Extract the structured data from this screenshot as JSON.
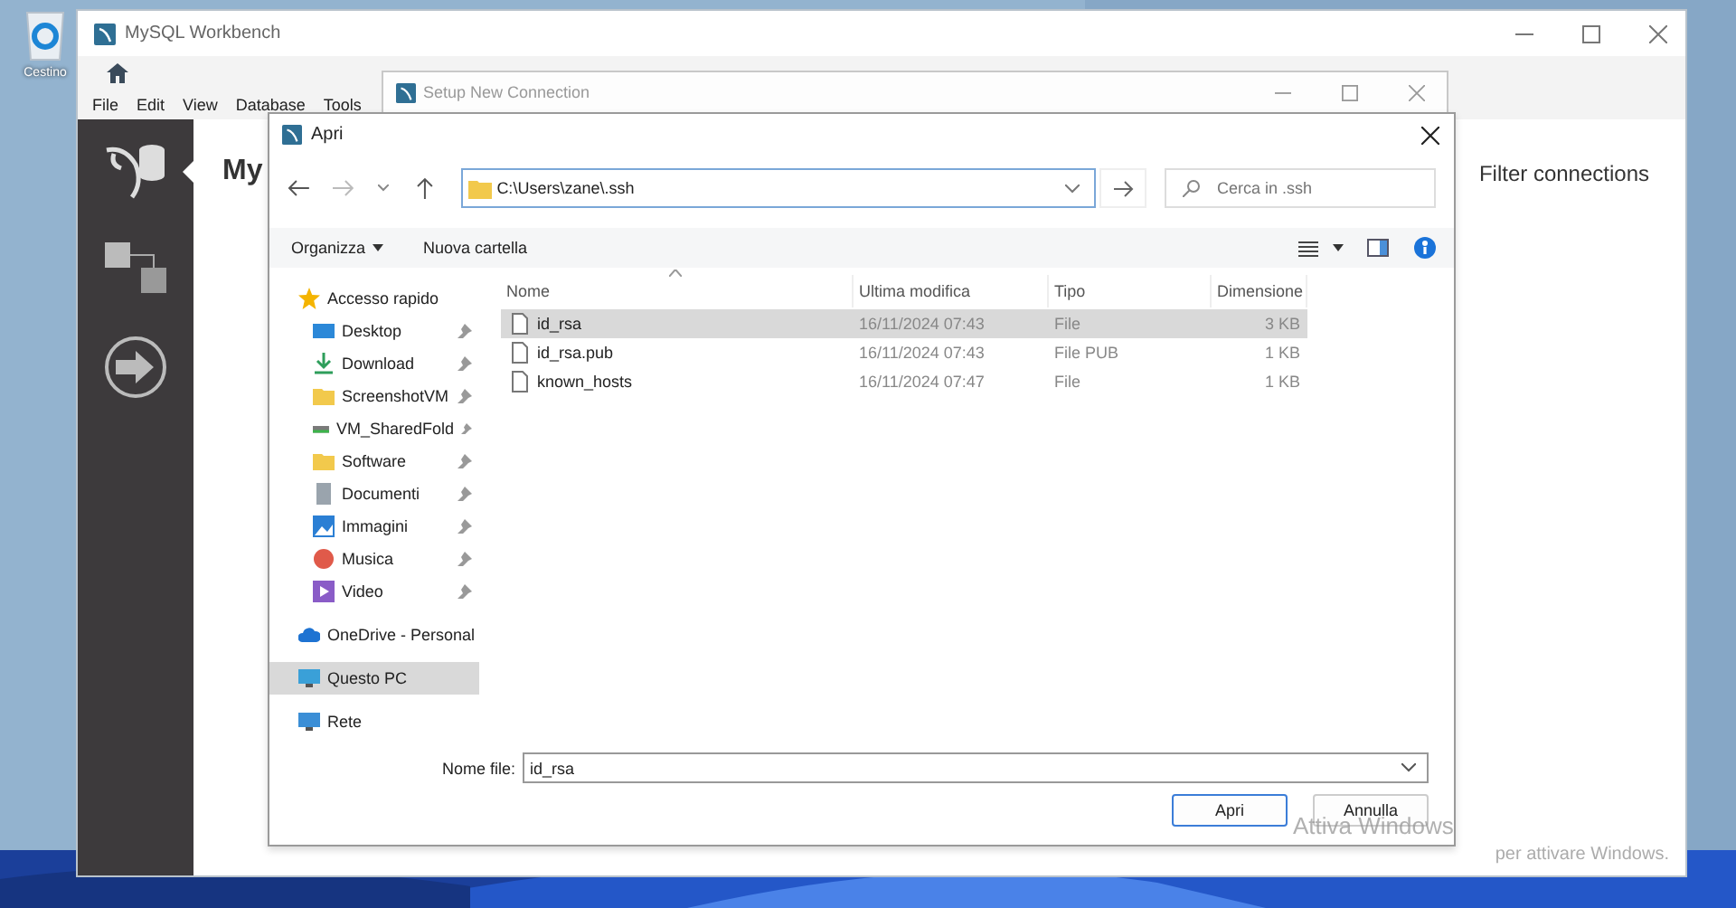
{
  "desktop": {
    "icons": [
      {
        "label": "Cestino"
      }
    ],
    "activation_notice": {
      "title": "Attiva Windows",
      "text": "per attivare Windows."
    }
  },
  "workbench": {
    "title": "MySQL Workbench",
    "menu": [
      "File",
      "Edit",
      "View",
      "Database",
      "Tools"
    ],
    "sidebar": [
      {
        "kind": "connections",
        "selected": true
      },
      {
        "kind": "models",
        "selected": false
      },
      {
        "kind": "migration",
        "selected": false
      }
    ],
    "heading": "My",
    "filter_label": "Filter connections"
  },
  "setup_dialog": {
    "title": "Setup New Connection"
  },
  "open_dialog": {
    "title": "Apri",
    "address": "C:\\Users\\zane\\.ssh",
    "search": {
      "placeholder": "Cerca in .ssh"
    },
    "toolbar": [
      {
        "label": "Organizza",
        "kind": "menu"
      },
      {
        "label": "Nuova cartella",
        "kind": "button"
      }
    ],
    "nav": [
      {
        "label": "Accesso rapido",
        "kind": "star",
        "selected": false,
        "children": [
          {
            "label": "Desktop",
            "kind": "desktop",
            "pinned": true,
            "selected": false
          },
          {
            "label": "Download",
            "kind": "download",
            "pinned": true,
            "selected": false
          },
          {
            "label": "ScreenshotVM",
            "kind": "folder",
            "pinned": true,
            "selected": false
          },
          {
            "label": "VM_SharedFold",
            "kind": "drive",
            "pinned": true,
            "selected": false
          },
          {
            "label": "Software",
            "kind": "folder",
            "pinned": true,
            "selected": false
          },
          {
            "label": "Documenti",
            "kind": "docs",
            "pinned": true,
            "selected": false
          },
          {
            "label": "Immagini",
            "kind": "pictures",
            "pinned": true,
            "selected": false
          },
          {
            "label": "Musica",
            "kind": "music",
            "pinned": true,
            "selected": false
          },
          {
            "label": "Video",
            "kind": "video",
            "pinned": true,
            "selected": false
          }
        ]
      },
      {
        "label": "OneDrive - Personal",
        "kind": "cloud",
        "selected": false
      },
      {
        "label": "Questo PC",
        "kind": "pc",
        "selected": true
      },
      {
        "label": "Rete",
        "kind": "network",
        "selected": false
      }
    ],
    "columns": [
      "Nome",
      "Ultima modifica",
      "Tipo",
      "Dimensione"
    ],
    "rows": [
      {
        "name": "id_rsa",
        "modified": "16/11/2024 07:43",
        "type": "File",
        "size": "3 KB",
        "selected": true
      },
      {
        "name": "id_rsa.pub",
        "modified": "16/11/2024 07:43",
        "type": "File PUB",
        "size": "1 KB",
        "selected": false
      },
      {
        "name": "known_hosts",
        "modified": "16/11/2024 07:47",
        "type": "File",
        "size": "1 KB",
        "selected": false
      }
    ],
    "filename_label": "Nome file:",
    "filename": "id_rsa",
    "buttons": [
      {
        "label": "Apri",
        "kind": "primary"
      },
      {
        "label": "Annulla",
        "kind": "secondary"
      }
    ]
  }
}
